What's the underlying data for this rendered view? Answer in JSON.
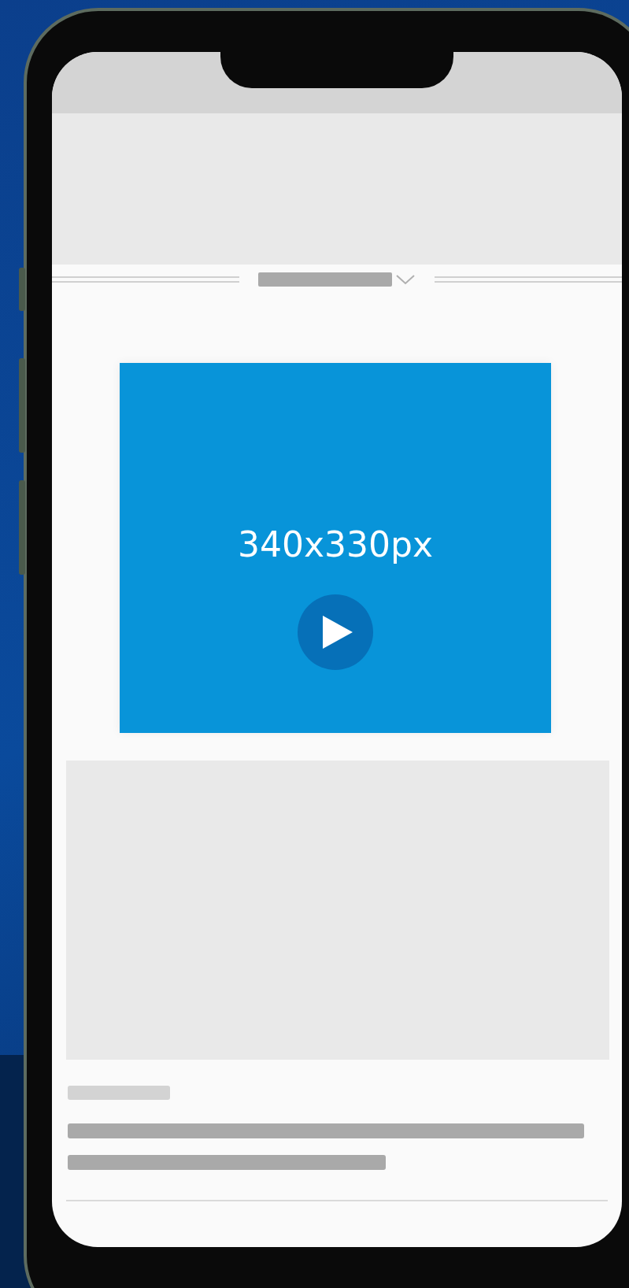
{
  "video": {
    "label": "340x330px"
  }
}
